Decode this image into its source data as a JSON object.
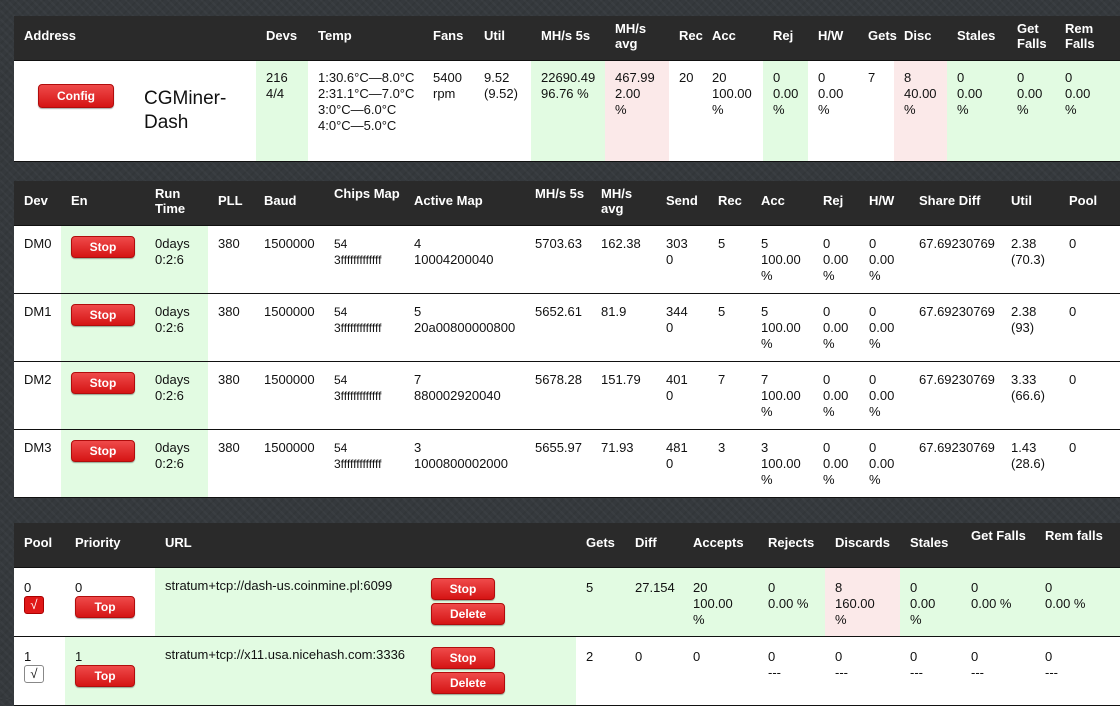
{
  "summary": {
    "headers": [
      "Address",
      "Devs",
      "Temp",
      "Fans",
      "Util",
      "MH/s 5s",
      "MH/s avg",
      "Rec",
      "Acc",
      "Rej",
      "H/W",
      "Gets",
      "Disc",
      "Stales",
      "Get Falls",
      "Rem Falls"
    ],
    "config_label": "Config",
    "name": "CGMiner-Dash",
    "devs": [
      "216",
      "4/4"
    ],
    "temp": [
      "1:30.6°C—8.0°C",
      "2:31.1°C—7.0°C",
      "3:0°C—6.0°C",
      "4:0°C—5.0°C"
    ],
    "fans": [
      "5400",
      "rpm"
    ],
    "util": [
      "9.52",
      "(9.52)"
    ],
    "mhs5s": [
      "22690.49",
      "96.76 %"
    ],
    "mhsavg": [
      "467.99",
      "2.00",
      "%"
    ],
    "rec": "20",
    "acc": [
      "20",
      "100.00",
      "%"
    ],
    "rej": [
      "0",
      "0.00",
      "%"
    ],
    "hw": [
      "0",
      "0.00",
      "%"
    ],
    "gets": "7",
    "disc": [
      "8",
      "40.00",
      "%"
    ],
    "stales": [
      "0",
      "0.00",
      "%"
    ],
    "getfalls": [
      "0",
      "0.00",
      "%"
    ],
    "remfalls": [
      "0",
      "0.00",
      "%"
    ]
  },
  "devices": {
    "headers": [
      "Dev",
      "En",
      "Run Time",
      "PLL",
      "Baud",
      "Chips Map",
      "Active Map",
      "MH/s 5s",
      "MH/s avg",
      "Send",
      "Rec",
      "Acc",
      "Rej",
      "H/W",
      "Share Diff",
      "Util",
      "Pool"
    ],
    "stop_label": "Stop",
    "rows": [
      {
        "dev": "DM0",
        "run": [
          "0days",
          "0:2:6"
        ],
        "pll": "380",
        "baud": "1500000",
        "chips": [
          "54",
          "3fffffffffffff"
        ],
        "active": [
          "4",
          "10004200040"
        ],
        "mhs5s": "5703.63",
        "mhsavg": "162.38",
        "send": [
          "303",
          "0"
        ],
        "rec": "5",
        "acc": [
          "5",
          "100.00",
          "%"
        ],
        "rej": [
          "0",
          "0.00",
          "%"
        ],
        "hw": [
          "0",
          "0.00",
          "%"
        ],
        "diff": "67.69230769",
        "util": [
          "2.38",
          "(70.3)"
        ],
        "pool": "0"
      },
      {
        "dev": "DM1",
        "run": [
          "0days",
          "0:2:6"
        ],
        "pll": "380",
        "baud": "1500000",
        "chips": [
          "54",
          "3fffffffffffff"
        ],
        "active": [
          "5",
          "20a00800000800"
        ],
        "mhs5s": "5652.61",
        "mhsavg": "81.9",
        "send": [
          "344",
          "0"
        ],
        "rec": "5",
        "acc": [
          "5",
          "100.00",
          "%"
        ],
        "rej": [
          "0",
          "0.00",
          "%"
        ],
        "hw": [
          "0",
          "0.00",
          "%"
        ],
        "diff": "67.69230769",
        "util": [
          "2.38",
          "(93)"
        ],
        "pool": "0"
      },
      {
        "dev": "DM2",
        "run": [
          "0days",
          "0:2:6"
        ],
        "pll": "380",
        "baud": "1500000",
        "chips": [
          "54",
          "3fffffffffffff"
        ],
        "active": [
          "7",
          "880002920040"
        ],
        "mhs5s": "5678.28",
        "mhsavg": "151.79",
        "send": [
          "401",
          "0"
        ],
        "rec": "7",
        "acc": [
          "7",
          "100.00",
          "%"
        ],
        "rej": [
          "0",
          "0.00",
          "%"
        ],
        "hw": [
          "0",
          "0.00",
          "%"
        ],
        "diff": "67.69230769",
        "util": [
          "3.33",
          "(66.6)"
        ],
        "pool": "0"
      },
      {
        "dev": "DM3",
        "run": [
          "0days",
          "0:2:6"
        ],
        "pll": "380",
        "baud": "1500000",
        "chips": [
          "54",
          "3fffffffffffff"
        ],
        "active": [
          "3",
          "1000800002000"
        ],
        "mhs5s": "5655.97",
        "mhsavg": "71.93",
        "send": [
          "481",
          "0"
        ],
        "rec": "3",
        "acc": [
          "3",
          "100.00",
          "%"
        ],
        "rej": [
          "0",
          "0.00",
          "%"
        ],
        "hw": [
          "0",
          "0.00",
          "%"
        ],
        "diff": "67.69230769",
        "util": [
          "1.43",
          "(28.6)"
        ],
        "pool": "0"
      }
    ]
  },
  "pools": {
    "headers": [
      "Pool",
      "Priority",
      "URL",
      "Gets",
      "Diff",
      "Accepts",
      "Rejects",
      "Discards",
      "Stales",
      "Get Falls",
      "Rem falls"
    ],
    "top_label": "Top",
    "stop_label": "Stop",
    "delete_label": "Delete",
    "check_glyph": "√",
    "rows": [
      {
        "pool": "0",
        "checked": true,
        "priority": "0",
        "url": "stratum+tcp://dash-us.coinmine.pl:6099",
        "gets": "5",
        "diff": "27.154",
        "accepts": [
          "20",
          "100.00",
          "%"
        ],
        "rejects": [
          "0",
          "0.00 %"
        ],
        "discards": [
          "8",
          "160.00",
          "%"
        ],
        "stales": [
          "0",
          "0.00",
          "%"
        ],
        "getfalls": [
          "0",
          "0.00 %"
        ],
        "remfalls": [
          "0",
          "0.00 %"
        ]
      },
      {
        "pool": "1",
        "checked": false,
        "priority": "1",
        "url": "stratum+tcp://x11.usa.nicehash.com:3336",
        "gets": "2",
        "diff": "0",
        "accepts": [
          "0"
        ],
        "rejects": [
          "0",
          "---"
        ],
        "discards": [
          "0",
          "---"
        ],
        "stales": [
          "0",
          "---"
        ],
        "getfalls": [
          "0",
          "---"
        ],
        "remfalls": [
          "0",
          "---"
        ]
      }
    ]
  }
}
